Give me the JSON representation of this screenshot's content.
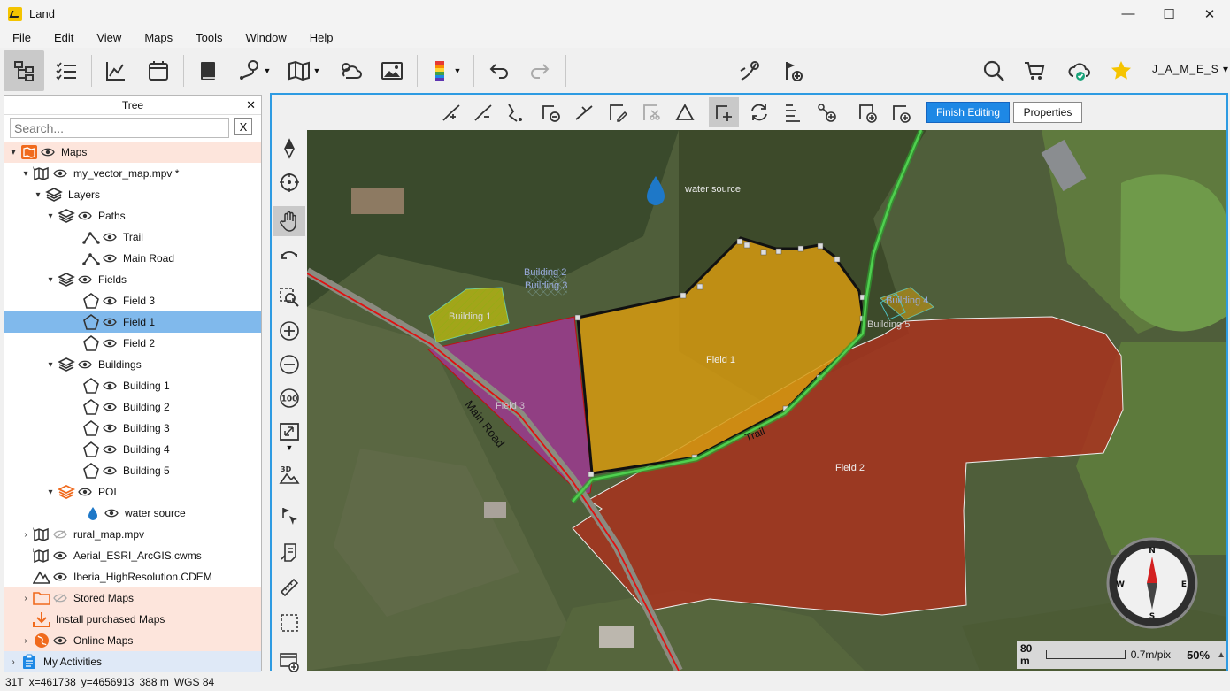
{
  "window": {
    "title": "Land",
    "minimize": "—",
    "maximize": "☐",
    "close": "✕"
  },
  "menu": [
    "File",
    "Edit",
    "View",
    "Maps",
    "Tools",
    "Window",
    "Help"
  ],
  "toolbar": {
    "user": "J_A_M_E_S",
    "user_caret": "▾"
  },
  "tree": {
    "title": "Tree",
    "close": "✕",
    "search_placeholder": "Search...",
    "clear": "X",
    "rows": [
      {
        "label": "Maps"
      },
      {
        "label": "my_vector_map.mpv   *"
      },
      {
        "label": "Layers"
      },
      {
        "label": "Paths"
      },
      {
        "label": "Trail"
      },
      {
        "label": "Main Road"
      },
      {
        "label": "Fields"
      },
      {
        "label": "Field 3"
      },
      {
        "label": "Field 1"
      },
      {
        "label": "Field 2"
      },
      {
        "label": "Buildings"
      },
      {
        "label": "Building 1"
      },
      {
        "label": "Building 2"
      },
      {
        "label": "Building 3"
      },
      {
        "label": "Building 4"
      },
      {
        "label": "Building 5"
      },
      {
        "label": "POI"
      },
      {
        "label": "water source"
      },
      {
        "label": "rural_map.mpv"
      },
      {
        "label": "Aerial_ESRI_ArcGIS.cwms"
      },
      {
        "label": "Iberia_HighResolution.CDEM"
      },
      {
        "label": "Stored Maps"
      },
      {
        "label": "Install purchased Maps"
      },
      {
        "label": "Online Maps"
      },
      {
        "label": "My Activities"
      }
    ]
  },
  "edit_toolbar": {
    "finish": "Finish Editing",
    "properties": "Properties"
  },
  "map": {
    "labels": {
      "water_source": "water source",
      "building1": "Building 1",
      "building2": "Building 2",
      "building3": "Building 3",
      "building4": "Building 4",
      "building5": "Building 5",
      "field1": "Field 1",
      "field2": "Field 2",
      "field3": "Field 3",
      "main_road": "Main Road",
      "trail": "Trail"
    },
    "compass": {
      "n": "N",
      "s": "S",
      "e": "E",
      "w": "W"
    },
    "scale": {
      "distance": "80 m",
      "resolution": "0.7m/pix",
      "zoom": "50%",
      "caret": "▲"
    },
    "colors": {
      "field1": "#d69a10",
      "field2": "#a8321e",
      "field3": "#9c3a90",
      "trail": "#4fd04f",
      "road": "#e01010",
      "accent": "#2e9be2"
    }
  },
  "status": {
    "zone": "31T",
    "x": "x=461738",
    "y": "y=4656913",
    "elev": "388 m",
    "datum": "WGS 84"
  }
}
